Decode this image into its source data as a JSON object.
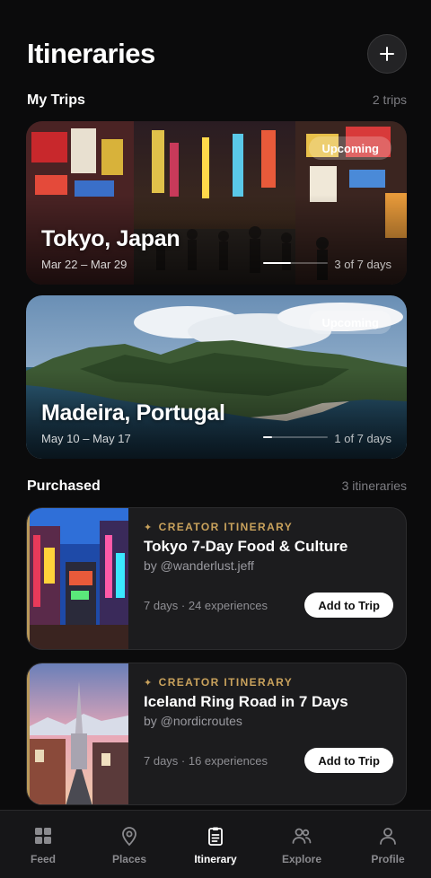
{
  "header": {
    "title": "Itineraries",
    "add_icon": "plus-icon"
  },
  "my_trips": {
    "title": "My Trips",
    "count": "2 trips",
    "cards": [
      {
        "destination": "Tokyo, Japan",
        "dates": "Mar 22 – Mar 29",
        "badge": "Upcoming",
        "progress_text": "3 of 7 days",
        "progress": 0.43
      },
      {
        "destination": "Madeira, Portugal",
        "dates": "May 10 – May 17",
        "badge": "Upcoming",
        "progress_text": "1 of 7 days",
        "progress": 0.14
      }
    ]
  },
  "purchased": {
    "title": "Purchased",
    "count": "3 itineraries",
    "items": [
      {
        "label": "CREATOR ITINERARY",
        "title": "Tokyo 7-Day Food & Culture",
        "author": "by @wanderlust.jeff",
        "meta": "7 days · 24 experiences",
        "button": "Add to Trip"
      },
      {
        "label": "CREATOR ITINERARY",
        "title": "Iceland Ring Road in 7 Days",
        "author": "by @nordicroutes",
        "meta": "7 days · 16 experiences",
        "button": "Add to Trip"
      }
    ]
  },
  "tabs": [
    {
      "label": "Feed",
      "icon": "grid-icon",
      "active": false
    },
    {
      "label": "Places",
      "icon": "map-pin-icon",
      "active": false
    },
    {
      "label": "Itinerary",
      "icon": "clipboard-icon",
      "active": true
    },
    {
      "label": "Explore",
      "icon": "users-icon",
      "active": false
    },
    {
      "label": "Profile",
      "icon": "person-icon",
      "active": false
    }
  ],
  "colors": {
    "background": "#0b0b0c",
    "card": "#1c1c1e",
    "creator_accent": "#c9a25c",
    "muted_text": "#7d7d82"
  }
}
